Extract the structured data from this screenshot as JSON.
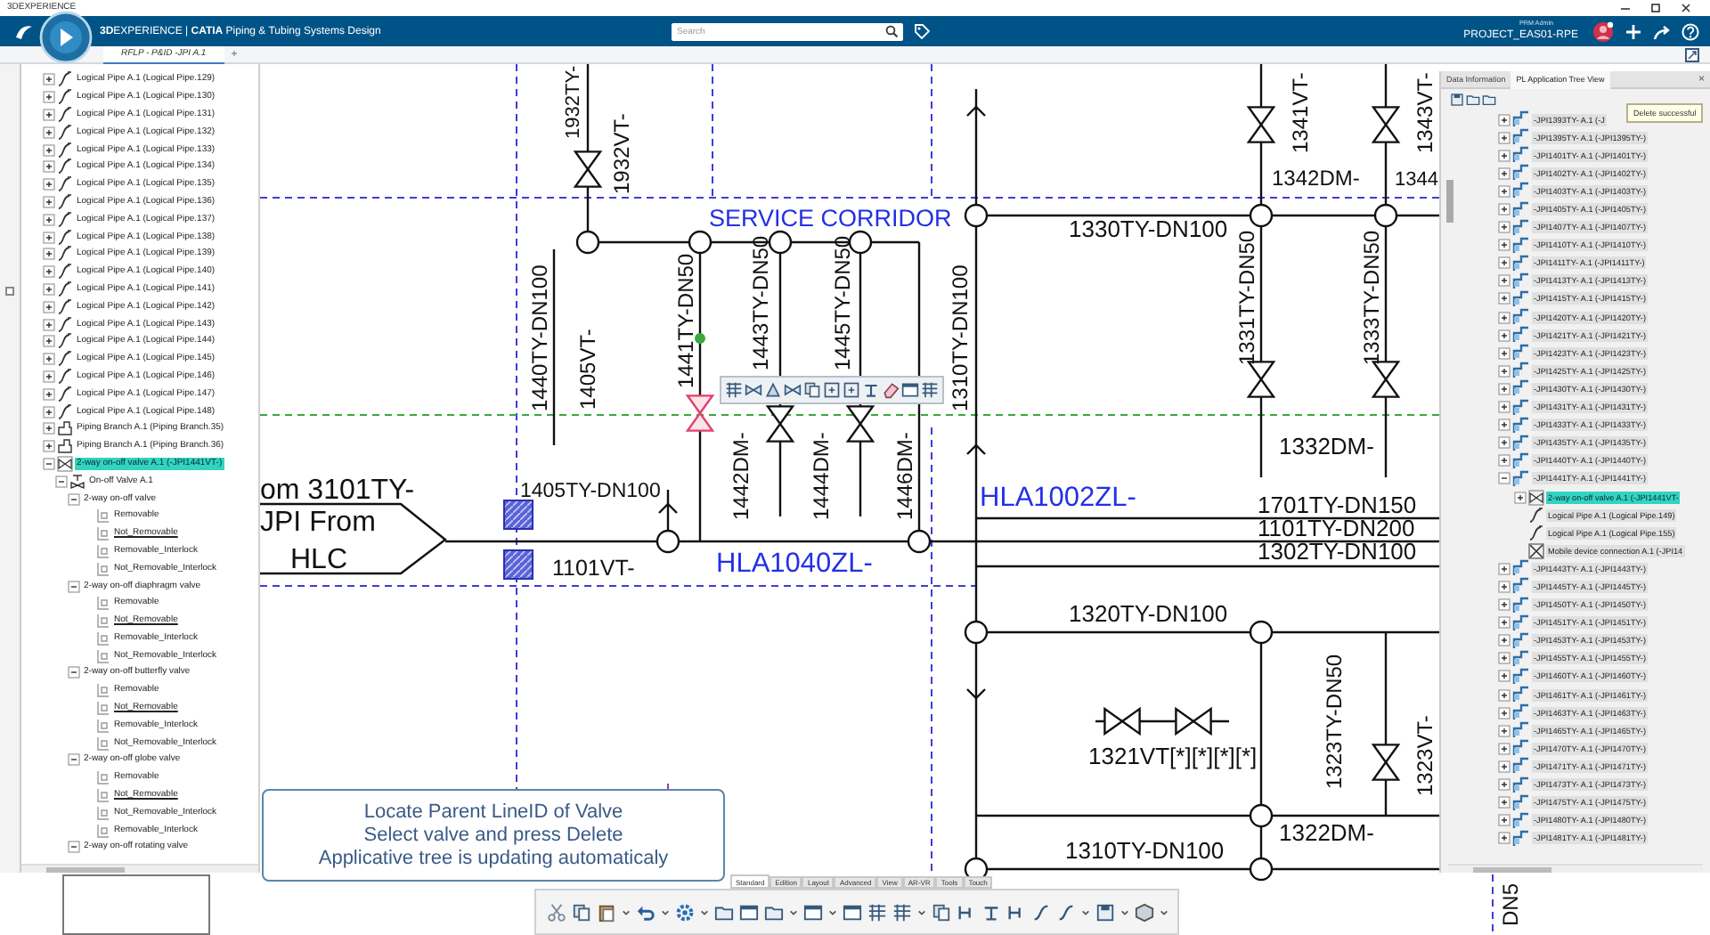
{
  "window": {
    "title": "3DEXPERIENCE"
  },
  "top_bar": {
    "brand": "**3D**EXPERIENCE | **CATIA** Piping & Tubing Systems Design",
    "search": {
      "placeholder": "Search"
    },
    "user_role": "PRM Admin",
    "project": "PROJECT_EAS01-RPE"
  },
  "doc_tabs": [
    {
      "label": "RFLP - P&ID -JPI A.1",
      "selected": true
    }
  ],
  "new_tab": "+",
  "left_tree": {
    "items": [
      {
        "label": "Logical Pipe A.1 (Logical Pipe.129)",
        "kind": "pipe",
        "expanded": false,
        "selected": false
      },
      {
        "label": "Logical Pipe A.1 (Logical Pipe.130)",
        "kind": "pipe",
        "expanded": false,
        "selected": false
      },
      {
        "label": "Logical Pipe A.1 (Logical Pipe.131)",
        "kind": "pipe",
        "expanded": false,
        "selected": false
      },
      {
        "label": "Logical Pipe A.1 (Logical Pipe.132)",
        "kind": "pipe",
        "expanded": false,
        "selected": false
      },
      {
        "label": "Logical Pipe A.1 (Logical Pipe.133)",
        "kind": "pipe",
        "expanded": false,
        "selected": false
      },
      {
        "label": "Logical Pipe A.1 (Logical Pipe.134)",
        "kind": "pipe",
        "expanded": false,
        "selected": false
      },
      {
        "label": "Logical Pipe A.1 (Logical Pipe.135)",
        "kind": "pipe",
        "expanded": false,
        "selected": false
      },
      {
        "label": "Logical Pipe A.1 (Logical Pipe.136)",
        "kind": "pipe",
        "expanded": false,
        "selected": false
      },
      {
        "label": "Logical Pipe A.1 (Logical Pipe.137)",
        "kind": "pipe",
        "expanded": false,
        "selected": false
      },
      {
        "label": "Logical Pipe A.1 (Logical Pipe.138)",
        "kind": "pipe",
        "expanded": false,
        "selected": false
      },
      {
        "label": "Logical Pipe A.1 (Logical Pipe.139)",
        "kind": "pipe",
        "expanded": false,
        "selected": false
      },
      {
        "label": "Logical Pipe A.1 (Logical Pipe.140)",
        "kind": "pipe",
        "expanded": false,
        "selected": false
      },
      {
        "label": "Logical Pipe A.1 (Logical Pipe.141)",
        "kind": "pipe",
        "expanded": false,
        "selected": false
      },
      {
        "label": "Logical Pipe A.1 (Logical Pipe.142)",
        "kind": "pipe",
        "expanded": false,
        "selected": false
      },
      {
        "label": "Logical Pipe A.1 (Logical Pipe.143)",
        "kind": "pipe",
        "expanded": false,
        "selected": false
      },
      {
        "label": "Logical Pipe A.1 (Logical Pipe.144)",
        "kind": "pipe",
        "expanded": false,
        "selected": false
      },
      {
        "label": "Logical Pipe A.1 (Logical Pipe.145)",
        "kind": "pipe",
        "expanded": false,
        "selected": false
      },
      {
        "label": "Logical Pipe A.1 (Logical Pipe.146)",
        "kind": "pipe",
        "expanded": false,
        "selected": false
      },
      {
        "label": "Logical Pipe A.1 (Logical Pipe.147)",
        "kind": "pipe",
        "expanded": false,
        "selected": false
      },
      {
        "label": "Logical Pipe A.1 (Logical Pipe.148)",
        "kind": "pipe",
        "expanded": false,
        "selected": false
      },
      {
        "label": "Piping Branch A.1 (Piping Branch.35)",
        "kind": "branch",
        "expanded": false,
        "selected": false
      },
      {
        "label": "Piping Branch A.1 (Piping Branch.36)",
        "kind": "branch",
        "expanded": false,
        "selected": false
      },
      {
        "label": "2-way on-off valve A.1 (-JPI1441VT-)",
        "kind": "valve",
        "expanded": true,
        "selected": true,
        "children": [
          {
            "label": "On-off Valve A.1",
            "kind": "part",
            "expanded": true,
            "selected": false,
            "children": [
              {
                "label": "2-way on-off valve",
                "expanded": true,
                "selected": false,
                "children": [
                  {
                    "label": "Removable",
                    "kind": "option",
                    "underlined": false,
                    "selected": false
                  },
                  {
                    "label": "Not_Removable",
                    "kind": "option",
                    "underlined": true,
                    "selected": false
                  },
                  {
                    "label": "Removable_Interlock",
                    "kind": "option",
                    "underlined": false,
                    "selected": false
                  },
                  {
                    "label": "Not_Removable_Interlock",
                    "kind": "option",
                    "underlined": false,
                    "selected": false
                  }
                ]
              },
              {
                "label": "2-way on-off diaphragm valve",
                "expanded": true,
                "selected": false,
                "children": [
                  {
                    "label": "Removable",
                    "kind": "option",
                    "underlined": false,
                    "selected": false
                  },
                  {
                    "label": "Not_Removable",
                    "kind": "option",
                    "underlined": true,
                    "selected": false
                  },
                  {
                    "label": "Removable_Interlock",
                    "kind": "option",
                    "underlined": false,
                    "selected": false
                  },
                  {
                    "label": "Not_Removable_Interlock",
                    "kind": "option",
                    "underlined": false,
                    "selected": false
                  }
                ]
              },
              {
                "label": "2-way on-off butterfly valve",
                "expanded": true,
                "selected": false,
                "children": [
                  {
                    "label": "Removable",
                    "kind": "option",
                    "underlined": false,
                    "selected": false
                  },
                  {
                    "label": "Not_Removable",
                    "kind": "option",
                    "underlined": true,
                    "selected": false
                  },
                  {
                    "label": "Removable_Interlock",
                    "kind": "option",
                    "underlined": false,
                    "selected": false
                  },
                  {
                    "label": "Not_Removable_Interlock",
                    "kind": "option",
                    "underlined": false,
                    "selected": false
                  }
                ]
              },
              {
                "label": "2-way on-off globe valve",
                "expanded": true,
                "selected": false,
                "children": [
                  {
                    "label": "Removable",
                    "kind": "option",
                    "underlined": false,
                    "selected": false
                  },
                  {
                    "label": "Not_Removable",
                    "kind": "option",
                    "underlined": true,
                    "selected": false
                  },
                  {
                    "label": "Not_Removable_Interlock",
                    "kind": "option",
                    "underlined": false,
                    "selected": false
                  },
                  {
                    "label": "Removable_Interlock",
                    "kind": "option",
                    "underlined": false,
                    "selected": false
                  }
                ]
              },
              {
                "label": "2-way on-off rotating valve",
                "expanded": true,
                "selected": false
              }
            ]
          }
        ]
      }
    ]
  },
  "diagram": {
    "labels": [
      {
        "text": "1932TY-",
        "kind": "pipe"
      },
      {
        "text": "1932VT-",
        "kind": "pipe"
      },
      {
        "text": "1440TY-DN100",
        "kind": "pipe"
      },
      {
        "text": "1405VT-",
        "kind": "pipe"
      },
      {
        "text": "1441TY-DN50",
        "kind": "pipe"
      },
      {
        "text": "1443TY-DN50",
        "kind": "pipe"
      },
      {
        "text": "1445TY-DN50",
        "kind": "pipe"
      },
      {
        "text": "1442DM-",
        "kind": "pipe"
      },
      {
        "text": "1444DM-",
        "kind": "pipe"
      },
      {
        "text": "1446DM-",
        "kind": "pipe"
      },
      {
        "text": "1310TY-DN100",
        "kind": "pipe"
      },
      {
        "text": "1341VT-",
        "kind": "pipe"
      },
      {
        "text": "1343VT-",
        "kind": "pipe"
      },
      {
        "text": "1331TY-DN50",
        "kind": "pipe"
      },
      {
        "text": "1333TY-DN50",
        "kind": "pipe"
      },
      {
        "text": "1323TY-DN50",
        "kind": "pipe"
      },
      {
        "text": "1323VT-",
        "kind": "pipe"
      },
      {
        "text": "DN5",
        "kind": "pipe"
      },
      {
        "text": "SERVICE CORRIDOR",
        "kind": "area"
      },
      {
        "text": "om 3101TY-",
        "kind": "pipe"
      },
      {
        "text": "JPI From",
        "kind": "pipe"
      },
      {
        "text": "HLC",
        "kind": "pipe"
      },
      {
        "text": "1405TY-DN100",
        "kind": "pipe"
      },
      {
        "text": "1101VT-",
        "kind": "pipe"
      },
      {
        "text": "HLA1040ZL-",
        "kind": "area"
      },
      {
        "text": "HLA1002ZL-",
        "kind": "area"
      },
      {
        "text": "1701TY-DN150",
        "kind": "pipe"
      },
      {
        "text": "1101TY-DN200",
        "kind": "pipe"
      },
      {
        "text": "1302TY-DN100",
        "kind": "pipe"
      },
      {
        "text": "1330TY-DN100",
        "kind": "pipe"
      },
      {
        "text": "1342DM-",
        "kind": "pipe"
      },
      {
        "text": "1344",
        "kind": "pipe"
      },
      {
        "text": "1332DM-",
        "kind": "pipe"
      },
      {
        "text": "1320TY-DN100",
        "kind": "pipe"
      },
      {
        "text": "1321VT[*][*][*][*]",
        "kind": "pipe"
      },
      {
        "text": "1322DM-",
        "kind": "pipe"
      },
      {
        "text": "1310TY-DN100",
        "kind": "pipe"
      }
    ]
  },
  "callout": {
    "lines": [
      "Locate Parent LineID of Valve",
      "Select valve and press Delete",
      "Applicative tree is updating automaticaly"
    ]
  },
  "right_panel": {
    "tabs": [
      {
        "label": "Data Information",
        "selected": false
      },
      {
        "label": "PL Application Tree View",
        "selected": true
      }
    ],
    "close": "×",
    "tooltip": "Delete successful",
    "items": [
      {
        "label": "-JPI1393TY- A.1 (-J",
        "kind": "line",
        "expanded": false,
        "selected": false
      },
      {
        "label": "-JPI1395TY- A.1 (-JPI1395TY-)",
        "kind": "line",
        "expanded": false,
        "selected": false
      },
      {
        "label": "-JPI1401TY- A.1 (-JPI1401TY-)",
        "kind": "line",
        "expanded": false,
        "selected": false
      },
      {
        "label": "-JPI1402TY- A.1 (-JPI1402TY-)",
        "kind": "line",
        "expanded": false,
        "selected": false
      },
      {
        "label": "-JPI1403TY- A.1 (-JPI1403TY-)",
        "kind": "line",
        "expanded": false,
        "selected": false
      },
      {
        "label": "-JPI1405TY- A.1 (-JPI1405TY-)",
        "kind": "line",
        "expanded": false,
        "selected": false
      },
      {
        "label": "-JPI1407TY- A.1 (-JPI1407TY-)",
        "kind": "line",
        "expanded": false,
        "selected": false
      },
      {
        "label": "-JPI1410TY- A.1 (-JPI1410TY-)",
        "kind": "line",
        "expanded": false,
        "selected": false
      },
      {
        "label": "-JPI1411TY- A.1 (-JPI1411TY-)",
        "kind": "line",
        "expanded": false,
        "selected": false
      },
      {
        "label": "-JPI1413TY- A.1 (-JPI1413TY-)",
        "kind": "line",
        "expanded": false,
        "selected": false
      },
      {
        "label": "-JPI1415TY- A.1 (-JPI1415TY-)",
        "kind": "line",
        "expanded": false,
        "selected": false
      },
      {
        "label": "-JPI1420TY- A.1 (-JPI1420TY-)",
        "kind": "line",
        "expanded": false,
        "selected": false
      },
      {
        "label": "-JPI1421TY- A.1 (-JPI1421TY-)",
        "kind": "line",
        "expanded": false,
        "selected": false
      },
      {
        "label": "-JPI1423TY- A.1 (-JPI1423TY-)",
        "kind": "line",
        "expanded": false,
        "selected": false
      },
      {
        "label": "-JPI1425TY- A.1 (-JPI1425TY-)",
        "kind": "line",
        "expanded": false,
        "selected": false
      },
      {
        "label": "-JPI1430TY- A.1 (-JPI1430TY-)",
        "kind": "line",
        "expanded": false,
        "selected": false
      },
      {
        "label": "-JPI1431TY- A.1 (-JPI1431TY-)",
        "kind": "line",
        "expanded": false,
        "selected": false
      },
      {
        "label": "-JPI1433TY- A.1 (-JPI1433TY-)",
        "kind": "line",
        "expanded": false,
        "selected": false
      },
      {
        "label": "-JPI1435TY- A.1 (-JPI1435TY-)",
        "kind": "line",
        "expanded": false,
        "selected": false
      },
      {
        "label": "-JPI1440TY- A.1 (-JPI1440TY-)",
        "kind": "line",
        "expanded": false,
        "selected": false
      },
      {
        "label": "-JPI1441TY- A.1 (-JPI1441TY-)",
        "kind": "line",
        "expanded": true,
        "selected": false,
        "children": [
          {
            "label": "2-way on-off valve A.1 (-JPI1441VT-",
            "kind": "valve",
            "expanded": false,
            "selected": true
          },
          {
            "label": "Logical Pipe A.1 (Logical Pipe.149)",
            "kind": "pipe",
            "selected": false
          },
          {
            "label": "Logical Pipe A.1 (Logical Pipe.155)",
            "kind": "pipe",
            "selected": false
          },
          {
            "label": "Mobile device connection A.1 (-JPI14",
            "kind": "connection",
            "selected": false
          }
        ]
      },
      {
        "label": "-JPI1443TY- A.1 (-JPI1443TY-)",
        "kind": "line",
        "expanded": false,
        "selected": false
      },
      {
        "label": "-JPI1445TY- A.1 (-JPI1445TY-)",
        "kind": "line",
        "expanded": false,
        "selected": false
      },
      {
        "label": "-JPI1450TY- A.1 (-JPI1450TY-)",
        "kind": "line",
        "expanded": false,
        "selected": false
      },
      {
        "label": "-JPI1451TY- A.1 (-JPI1451TY-)",
        "kind": "line",
        "expanded": false,
        "selected": false
      },
      {
        "label": "-JPI1453TY- A.1 (-JPI1453TY-)",
        "kind": "line",
        "expanded": false,
        "selected": false
      },
      {
        "label": "-JPI1455TY- A.1 (-JPI1455TY-)",
        "kind": "line",
        "expanded": false,
        "selected": false
      },
      {
        "label": "-JPI1460TY- A.1 (-JPI1460TY-)",
        "kind": "line",
        "expanded": false,
        "selected": false
      },
      {
        "label": "-JPI1461TY- A.1 (-JPI1461TY-)",
        "kind": "line",
        "expanded": false,
        "selected": false
      },
      {
        "label": "-JPI1463TY- A.1 (-JPI1463TY-)",
        "kind": "line",
        "expanded": false,
        "selected": false
      },
      {
        "label": "-JPI1465TY- A.1 (-JPI1465TY-)",
        "kind": "line",
        "expanded": false,
        "selected": false
      },
      {
        "label": "-JPI1470TY- A.1 (-JPI1470TY-)",
        "kind": "line",
        "expanded": false,
        "selected": false
      },
      {
        "label": "-JPI1471TY- A.1 (-JPI1471TY-)",
        "kind": "line",
        "expanded": false,
        "selected": false
      },
      {
        "label": "-JPI1473TY- A.1 (-JPI1473TY-)",
        "kind": "line",
        "expanded": false,
        "selected": false
      },
      {
        "label": "-JPI1475TY- A.1 (-JPI1475TY-)",
        "kind": "line",
        "expanded": false,
        "selected": false
      },
      {
        "label": "-JPI1480TY- A.1 (-JPI1480TY-)",
        "kind": "line",
        "expanded": false,
        "selected": false
      },
      {
        "label": "-JPI1481TY- A.1 (-JPI1481TY-)",
        "kind": "line",
        "expanded": false,
        "selected": false
      }
    ]
  },
  "toolbar": {
    "tabs": [
      {
        "label": "Standard",
        "selected": true
      },
      {
        "label": "Edition",
        "selected": false
      },
      {
        "label": "Layout",
        "selected": false
      },
      {
        "label": "Advanced",
        "selected": false
      },
      {
        "label": "View",
        "selected": false
      },
      {
        "label": "AR-VR",
        "selected": false
      },
      {
        "label": "Tools",
        "selected": false
      },
      {
        "label": "Touch",
        "selected": false
      }
    ]
  }
}
